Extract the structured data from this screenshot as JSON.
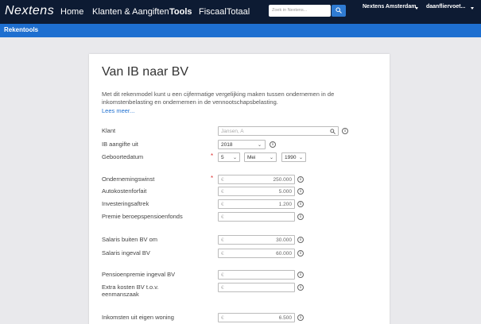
{
  "topnav": {
    "logo": "Nextens",
    "items": [
      {
        "label": "Home"
      },
      {
        "label": "Klanten & Aangiften"
      },
      {
        "label": "Tools"
      },
      {
        "label": "FiscaalTotaal"
      }
    ],
    "search_placeholder": "Zoek in Nextens...",
    "organisation": "Nextens Amsterdam",
    "user": "daanfliervoet..."
  },
  "subbar": {
    "title": "Rekentools"
  },
  "card": {
    "title": "Van IB naar BV",
    "description": "Met dit rekenmodel kunt u een cijfermatige vergelijking maken tussen ondernemen in de inkomstenbelasting en ondernemen in de vennootschapsbelasting.",
    "lees_meer": "Lees meer...",
    "currency": "€",
    "required_mark": "*",
    "fields": {
      "klant": {
        "label": "Klant",
        "placeholder": "Jansen, A"
      },
      "ib_aangifte": {
        "label": "IB aangifte uit",
        "value": "2018"
      },
      "geboortedatum": {
        "label": "Geboortedatum",
        "day": "5",
        "month": "Mei",
        "year": "1990"
      },
      "ondernemingswinst": {
        "label": "Ondernemingswinst",
        "value": "250.000"
      },
      "autokostenforfait": {
        "label": "Autokostenforfait",
        "value": "5.000"
      },
      "investeringsaftrek": {
        "label": "Investeringsaftrek",
        "value": "1.200"
      },
      "premie_beroepspensioen": {
        "label": "Premie beroepspensioenfonds",
        "value": ""
      },
      "salaris_buiten": {
        "label": "Salaris buiten BV om",
        "value": "30.000"
      },
      "salaris_ingeval": {
        "label": "Salaris ingeval BV",
        "value": "60.000"
      },
      "pensioenpremie": {
        "label": "Pensioenpremie ingeval BV",
        "value": ""
      },
      "extra_kosten": {
        "label": "Extra kosten BV t.o.v. eenmanszaak",
        "value": ""
      },
      "eigen_woning": {
        "label": "Inkomsten uit eigen woning",
        "value": "6.500"
      }
    }
  }
}
